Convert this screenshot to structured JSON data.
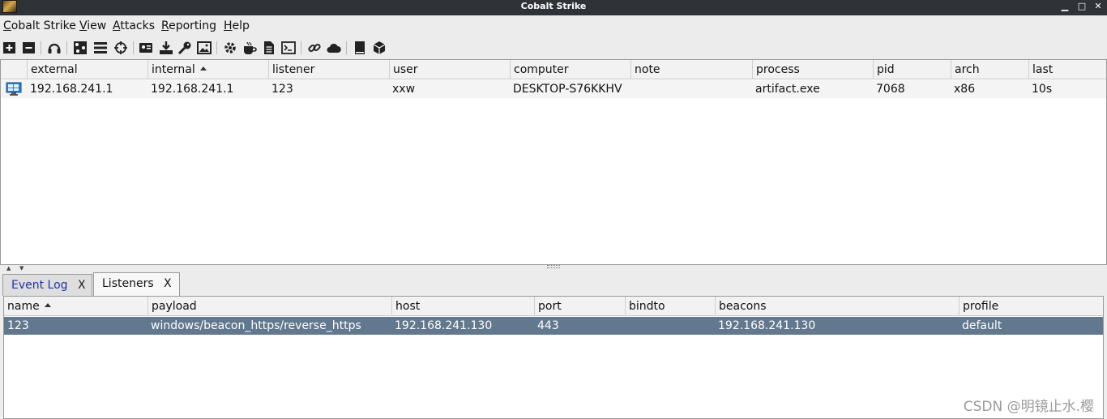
{
  "window": {
    "title": "Cobalt Strike",
    "minimize": "▁",
    "maximize": "□",
    "close": "✕"
  },
  "menu": [
    "Cobalt Strike",
    "View",
    "Attacks",
    "Reporting",
    "Help"
  ],
  "toolbar_icons": [
    "new-connection-icon",
    "disconnect-icon",
    "listeners-icon",
    "pivot-graph-icon",
    "session-table-icon",
    "targets-icon",
    "credentials-icon",
    "downloads-icon",
    "keystrokes-icon",
    "screenshots-icon",
    "payload-generator-icon",
    "manage-web-server-icon",
    "host-file-icon",
    "scripted-web-delivery-icon",
    "copy-url-icon",
    "manage-sites-icon",
    "help-icon",
    "about-icon"
  ],
  "sessions": {
    "columns": [
      "external",
      "internal",
      "listener",
      "user",
      "computer",
      "note",
      "process",
      "pid",
      "arch",
      "last"
    ],
    "sorted_column": "internal",
    "rows": [
      {
        "icon": "windows-beacon-icon",
        "external": "192.168.241.1",
        "internal": "192.168.241.1",
        "listener": "123",
        "user": "xxw",
        "computer": "DESKTOP-S76KKHV",
        "note": "",
        "process": "artifact.exe",
        "pid": "7068",
        "arch": "x86",
        "last": "10s"
      }
    ]
  },
  "tabs": [
    {
      "label": "Event Log",
      "close": "X",
      "active": false
    },
    {
      "label": "Listeners",
      "close": "X",
      "active": true
    }
  ],
  "listeners": {
    "columns": [
      "name",
      "payload",
      "host",
      "port",
      "bindto",
      "beacons",
      "profile"
    ],
    "sorted_column": "name",
    "rows": [
      {
        "name": "123",
        "payload": "windows/beacon_https/reverse_https",
        "host": "192.168.241.130",
        "port": "443",
        "bindto": "",
        "beacons": "192.168.241.130",
        "profile": "default",
        "selected": true
      }
    ]
  },
  "colors": {
    "selection": "#62788f",
    "titlebar": "#2f3337",
    "tab_inactive_text": "#2233aa"
  },
  "watermark": "CSDN @明镜止水.樱"
}
